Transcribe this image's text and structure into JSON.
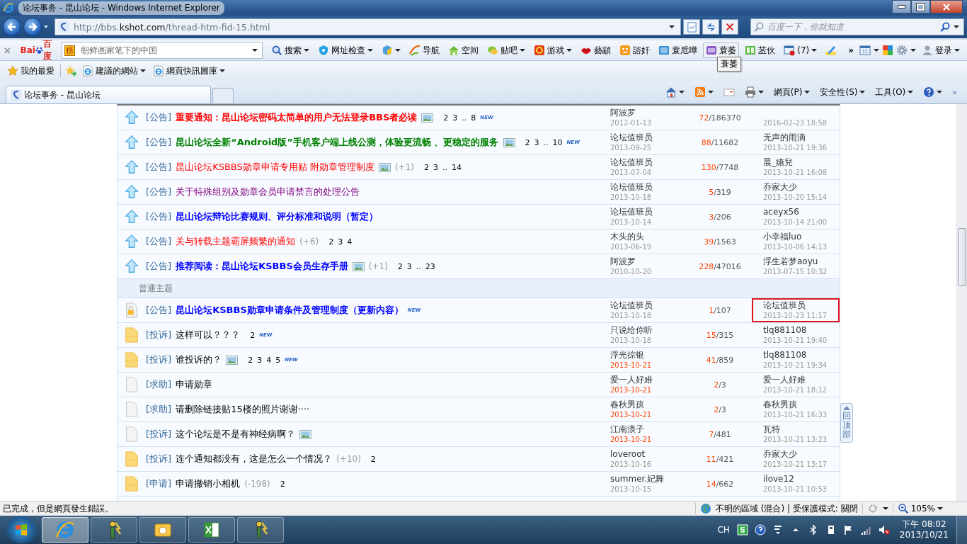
{
  "window": {
    "title": "论坛事务 - 昆山论坛 - Windows Internet Explorer"
  },
  "address_bar": {
    "url_prefix": "http://bbs.",
    "url_domain": "kshot.com",
    "url_path": "/thread-htm-fid-15.html"
  },
  "search_box": {
    "placeholder": "百度一下，你就知道"
  },
  "baidu_toolbar": {
    "logo": [
      "Bai",
      "百度"
    ],
    "badge": "榜",
    "query": "朝鲜画家笔下的中国",
    "items": [
      {
        "kind": "search",
        "label": "搜索",
        "menu": true,
        "hovered": false
      },
      {
        "kind": "shield",
        "label": "网址检查",
        "menu": true,
        "hovered": false
      },
      {
        "kind": "cube",
        "menu": true,
        "hovered": false
      },
      {
        "kind": "hao",
        "label": "导航",
        "menu": false,
        "hovered": false
      },
      {
        "kind": "house",
        "label": "空间",
        "menu": false,
        "hovered": false
      },
      {
        "kind": "chat",
        "label": "贴吧",
        "menu": true,
        "hovered": false
      },
      {
        "kind": "game",
        "label": "游戏",
        "menu": true,
        "hovered": false
      },
      {
        "kind": "lips",
        "label": "藝顓",
        "menu": false,
        "hovered": false
      },
      {
        "kind": "face",
        "label": "諮奸",
        "menu": false,
        "hovered": false
      },
      {
        "kind": "tv",
        "label": "蓑卮嘩",
        "menu": false,
        "hovered": false
      },
      {
        "kind": "hd",
        "label": "蓑萎",
        "menu": false,
        "hovered": true
      },
      {
        "kind": "book",
        "label": "苤伙",
        "menu": false,
        "hovered": false
      },
      {
        "kind": "popup",
        "label": "(7)",
        "menu": true,
        "hovered": false
      },
      {
        "kind": "pen",
        "menu": false,
        "hovered": false
      }
    ],
    "overflow": "»",
    "tooltip": "蓑萎",
    "login": "登录"
  },
  "favorites_bar": {
    "label": "我的最愛",
    "items": [
      {
        "label": "建議的網站"
      },
      {
        "label": "網頁快訊圖庫"
      }
    ]
  },
  "tabs": [
    {
      "label": "论坛事务 - 昆山论坛",
      "selected": true
    }
  ],
  "command_bar": {
    "items": [
      {
        "kind": "home",
        "menu": true
      },
      {
        "kind": "rss",
        "menu": true
      },
      {
        "kind": "mail",
        "menu": false
      },
      {
        "kind": "print",
        "menu": true
      },
      {
        "kind": "menu",
        "label": "網頁(P)",
        "menu": true
      },
      {
        "kind": "menu",
        "label": "安全性(S)",
        "menu": true
      },
      {
        "kind": "menu",
        "label": "工具(O)",
        "menu": true
      },
      {
        "kind": "help",
        "menu": true
      }
    ],
    "overflow": "»"
  },
  "threads": [
    {
      "kind": "pinned",
      "tag": "[公告]",
      "title": "重要通知：昆山论坛密码太简单的用户无法登录BBS者必读",
      "color": "#ff0000",
      "bold": true,
      "image": true,
      "pages": [
        "2",
        "3",
        "..",
        "8"
      ],
      "new_badge": "NEW",
      "author": "阿波罗",
      "date": "2012-01-13",
      "date_recent": false,
      "replies": "72",
      "views": "/186370",
      "last_time": "2016-02-23 18:58",
      "marked": false
    },
    {
      "kind": "pinned",
      "tag": "[公告]",
      "title": "昆山论坛全新“Android版”手机客户端上线公测，体验更流畅 、更稳定的服务",
      "color": "#008000",
      "bold": true,
      "image": true,
      "pages": [
        "2",
        "3",
        "..",
        "10"
      ],
      "new_badge": "NEW",
      "author": "论坛值班员",
      "date": "2013-09-25",
      "date_recent": false,
      "replies": "88",
      "views": "/11682",
      "last_user": "无声的雨滴",
      "last_time": "2013-10-21 19:36",
      "marked": false
    },
    {
      "kind": "pinned",
      "tag": "[公告]",
      "title": "昆山论坛KSBBS勋章申请专用贴 附勋章管理制度",
      "color": "#ff0000",
      "bold": false,
      "image": true,
      "rating": "(+1)",
      "pages": [
        "2",
        "3",
        "..",
        "14"
      ],
      "author": "论坛值班员",
      "date": "2013-07-04",
      "date_recent": false,
      "replies": "130",
      "views": "/7748",
      "last_user": "晨_嬿兒",
      "last_time": "2013-10-21 16:08",
      "marked": false
    },
    {
      "kind": "pinned",
      "tag": "[公告]",
      "title": "关于特殊组别及勋章会员申请禁言的处理公告",
      "color": "#800080",
      "bold": false,
      "image": false,
      "author": "论坛值班员",
      "date": "2013-10-18",
      "date_recent": false,
      "replies": "5",
      "views": "/319",
      "last_user": "乔家大少",
      "last_time": "2013-10-20 15:14",
      "marked": false
    },
    {
      "kind": "pinned",
      "tag": "[公告]",
      "title": "昆山论坛辩论比赛规则、评分标准和说明（暂定）",
      "color": "#0000ff",
      "bold": true,
      "image": false,
      "author": "论坛值班员",
      "date": "2013-10-14",
      "date_recent": false,
      "replies": "3",
      "views": "/206",
      "last_user": "aceyx56",
      "last_time": "2013-10-14 21:00",
      "marked": false
    },
    {
      "kind": "pinned",
      "tag": "[公告]",
      "title": "关与转载主题霸屏频繁的通知",
      "color": "#ff0000",
      "bold": false,
      "image": false,
      "rating": "(+6)",
      "pages": [
        "2",
        "3",
        "4"
      ],
      "author": "木头的头",
      "date": "2013-06-19",
      "date_recent": false,
      "replies": "39",
      "views": "/1563",
      "last_user": "小幸福luo",
      "last_time": "2013-10-06 14:13",
      "marked": false
    },
    {
      "kind": "pinned",
      "tag": "[公告]",
      "title": "推荐阅读：昆山论坛KSBBS会员生存手册",
      "color": "#0000ff",
      "bold": true,
      "image": true,
      "rating": "(+1)",
      "pages": [
        "2",
        "3",
        "..",
        "23"
      ],
      "author": "阿波罗",
      "date": "2010-10-20",
      "date_recent": false,
      "replies": "228",
      "views": "/47016",
      "last_user": "浮生若梦aoyu",
      "last_time": "2013-07-15 10:32",
      "marked": false
    },
    {
      "kind": "section",
      "label": "普通主题"
    },
    {
      "kind": "locked",
      "tag": "[公告]",
      "title": "昆山论坛KSBBS勋章申请条件及管理制度（更新内容）",
      "color": "#0000ff",
      "bold": true,
      "image": false,
      "new_badge": "NEW",
      "author": "论坛值班员",
      "date": "2013-10-18",
      "date_recent": false,
      "replies": "1",
      "views": "/107",
      "last_user": "论坛值班员",
      "last_time": "2013-10-23 11:17",
      "marked": true
    },
    {
      "kind": "hot",
      "tag": "[投诉]",
      "title": "这样可以？？？",
      "bold": false,
      "image": false,
      "pages": [
        "2"
      ],
      "new_badge": "NEW",
      "author": "只说给你听",
      "date": "2013-10-18",
      "date_recent": false,
      "replies": "15",
      "views": "/315",
      "last_user": "tlq881108",
      "last_time": "2013-10-21 19:40",
      "marked": false
    },
    {
      "kind": "hot",
      "tag": "[投诉]",
      "title": "谁投诉的？",
      "bold": false,
      "image": true,
      "pages": [
        "2",
        "3",
        "4",
        "5"
      ],
      "new_badge": "NEW",
      "author": "浮光掠银",
      "date": "2013-10-21",
      "date_recent": true,
      "replies": "41",
      "views": "/859",
      "last_user": "tlq881108",
      "last_time": "2013-10-21 19:34",
      "marked": false
    },
    {
      "kind": "normal",
      "tag": "[求助]",
      "title": "申请勋章",
      "bold": false,
      "image": false,
      "author": "爱一人好难",
      "date": "2013-10-21",
      "date_recent": true,
      "replies": "2",
      "views": "/3",
      "last_user": "爱一人好难",
      "last_time": "2013-10-21 18:12",
      "marked": false
    },
    {
      "kind": "normal",
      "tag": "[求助]",
      "title": "请删除链接贴15楼的照片谢谢····",
      "bold": false,
      "image": false,
      "author": "春秋男孩",
      "date": "2013-10-21",
      "date_recent": true,
      "replies": "2",
      "views": "/3",
      "last_user": "春秋男孩",
      "last_time": "2013-10-21 16:33",
      "marked": false
    },
    {
      "kind": "normal",
      "tag": "[投诉]",
      "title": "这个论坛是不是有神经病啊？",
      "bold": false,
      "image": true,
      "author": "江南浪子",
      "date": "2013-10-21",
      "date_recent": true,
      "replies": "7",
      "views": "/481",
      "last_user": "瓦特",
      "last_time": "2013-10-21 13:23",
      "marked": false
    },
    {
      "kind": "hot",
      "tag": "[投诉]",
      "title": "连个通知都没有，这是怎么一个情况？",
      "bold": false,
      "image": false,
      "rating": "(+10)",
      "pages": [
        "2"
      ],
      "author": "loveroot",
      "date": "2013-10-16",
      "date_recent": false,
      "replies": "11",
      "views": "/421",
      "last_user": "乔家大少",
      "last_time": "2013-10-21 13:17",
      "marked": false
    },
    {
      "kind": "hot",
      "tag": "[申请]",
      "title": "申请撤销小相机",
      "bold": false,
      "image": false,
      "rating": "(-198)",
      "pages": [
        "2"
      ],
      "author": "summer.妃舞",
      "date": "2013-10-15",
      "date_recent": false,
      "replies": "14",
      "views": "/662",
      "last_user": "ilove12",
      "last_time": "2013-10-21 10:53",
      "marked": false
    }
  ],
  "back_to_top": "回顶部",
  "status_bar": {
    "message": "已完成，但是網頁發生錯誤。",
    "zone": "不明的區域 (混合) | 受保護模式: 關閉",
    "zoom": "105%"
  },
  "taskbar": {
    "apps": [
      {
        "kind": "ie",
        "selected": true
      },
      {
        "kind": "figure",
        "selected": false
      },
      {
        "kind": "mail",
        "selected": false
      },
      {
        "kind": "excel",
        "selected": false
      },
      {
        "kind": "figure",
        "selected": false
      }
    ],
    "language": "CH",
    "time": "下午 08:02",
    "date": "2013/10/21"
  }
}
